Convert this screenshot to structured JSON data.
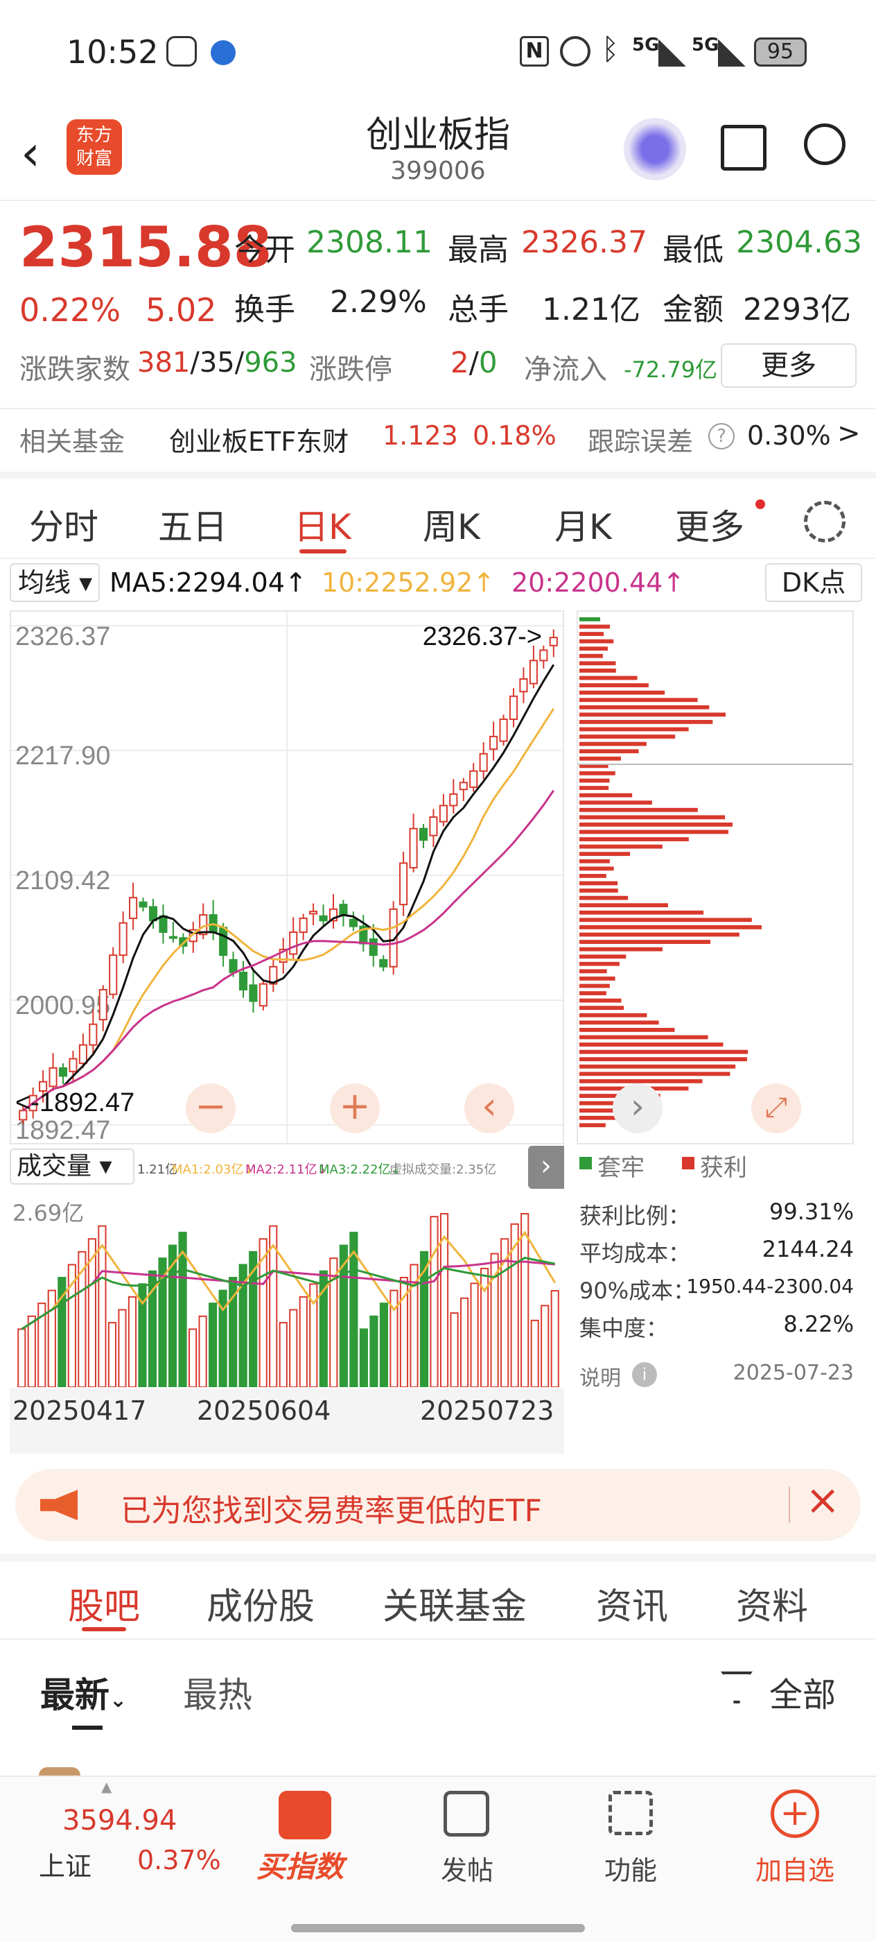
{
  "status": {
    "time": "10:52",
    "battery": "95",
    "net1": "5G",
    "net2": "5G"
  },
  "header": {
    "title": "创业板指",
    "code": "399006"
  },
  "quote": {
    "price": "2315.88",
    "change_pct": "0.22%",
    "change": "5.02",
    "open_label": "今开",
    "open": "2308.11",
    "high_label": "最高",
    "high": "2326.37",
    "low_label": "最低",
    "low": "2304.63",
    "turnover_label": "换手",
    "turnover": "2.29%",
    "vol_label": "总手",
    "vol": "1.21亿",
    "amt_label": "金额",
    "amt": "2293亿",
    "breadth_label": "涨跌家数",
    "breadth_up": "381",
    "breadth_flat": "/35/",
    "breadth_down": "963",
    "limit_label": "涨跌停",
    "limit_up": "2",
    "limit_sep": "/",
    "limit_down": "0",
    "flow_label": "净流入",
    "flow": "-72.79亿",
    "more": "更多",
    "fund_label": "相关基金",
    "fund_name": "创业板ETF东财",
    "fund_price": "1.123",
    "fund_pct": "0.18%",
    "te_label": "跟踪误差",
    "te": "0.30%",
    "te_arrow": ">"
  },
  "tabs": [
    "分时",
    "五日",
    "日K",
    "周K",
    "月K",
    "更多"
  ],
  "ma": {
    "selector": "均线",
    "ma5": "MA5:2294.04↑",
    "ma10": "10:2252.92↑",
    "ma20": "20:2200.44↑",
    "dk": "DK点"
  },
  "chart_data": {
    "type": "candlestick",
    "y_ticks": [
      "2326.37",
      "2217.90",
      "2109.42",
      "2000.95",
      "1892.47"
    ],
    "ylim": [
      1892.47,
      2326.37
    ],
    "high_label": "2326.37->",
    "low_label": "<-1892.47",
    "closes": [
      1905,
      1918,
      1930,
      1942,
      1935,
      1950,
      1962,
      1980,
      2010,
      2040,
      2068,
      2090,
      2082,
      2070,
      2060,
      2055,
      2048,
      2062,
      2075,
      2060,
      2040,
      2025,
      2010,
      2000,
      2015,
      2030,
      2045,
      2060,
      2072,
      2078,
      2070,
      2080,
      2075,
      2065,
      2050,
      2040,
      2030,
      2080,
      2120,
      2150,
      2140,
      2160,
      2170,
      2180,
      2190,
      2200,
      2215,
      2230,
      2245,
      2265,
      2280,
      2296,
      2305,
      2316
    ],
    "volume": {
      "label": "成交量",
      "summary": "1.21亿",
      "ma1": "MA1:2.03亿↓",
      "ma2": "MA2:2.11亿↓",
      "ma3": "MA3:2.22亿↓",
      "virtual": "虚拟成交量:2.35亿",
      "max": "2.69亿"
    },
    "dates": [
      "20250417",
      "20250604",
      "20250723"
    ]
  },
  "cost": {
    "legend_trap": "套牢",
    "legend_profit": "获利",
    "rows": [
      {
        "k": "获利比例：",
        "v": "99.31%"
      },
      {
        "k": "平均成本：",
        "v": "2144.24"
      },
      {
        "k": "90%成本：",
        "v": "1950.44-2300.04"
      },
      {
        "k": "集中度：",
        "v": "8.22%"
      }
    ],
    "note": "说明",
    "date": "2025-07-23"
  },
  "banner": {
    "text": "已为您找到交易费率更低的ETF"
  },
  "nav": [
    "股吧",
    "成份股",
    "关联基金",
    "资讯",
    "资料"
  ],
  "subnav": {
    "latest": "最新",
    "hot": "最热",
    "filter": "全部"
  },
  "bottom": {
    "index_name": "上证",
    "index_price": "3594.94",
    "index_pct": "0.37%",
    "buy": "买指数",
    "post": "发帖",
    "func": "功能",
    "watch": "加自选"
  },
  "colors": {
    "up": "#d8392c",
    "down": "#2f9a38",
    "ma5": "#111111",
    "ma10": "#f0b43c",
    "ma20": "#c8338c"
  }
}
